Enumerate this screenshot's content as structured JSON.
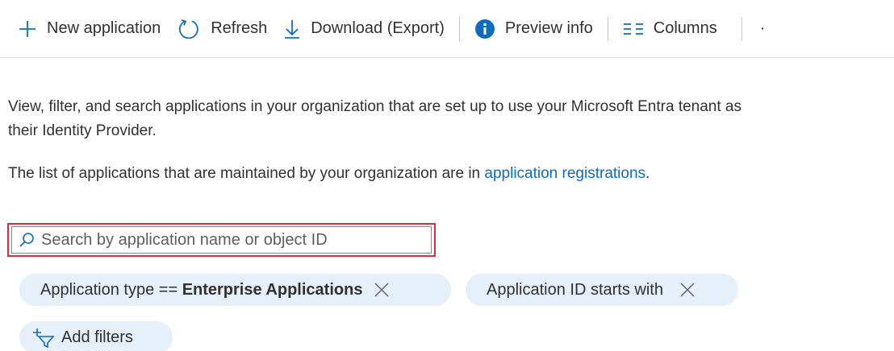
{
  "toolbar": {
    "new_application": "New application",
    "refresh": "Refresh",
    "download": "Download (Export)",
    "preview_info": "Preview info",
    "columns": "Columns",
    "more": "·"
  },
  "description": {
    "line1": "View, filter, and search applications in your organization that are set up to use your Microsoft Entra tenant as",
    "line2": "their Identity Provider.",
    "line3_prefix": "The list of applications that are maintained by your organization are in ",
    "line3_link": "application registrations",
    "line3_suffix": "."
  },
  "search": {
    "placeholder": "Search by application name or object ID",
    "value": ""
  },
  "filters": [
    {
      "label_prefix": "Application type == ",
      "label_value": "Enterprise Applications"
    },
    {
      "label_prefix": "Application ID starts with",
      "label_value": ""
    }
  ],
  "add_filters": "Add filters",
  "colors": {
    "accent": "#0f6cbd",
    "pill_bg": "#e5f0fb",
    "highlight": "#d13438"
  }
}
